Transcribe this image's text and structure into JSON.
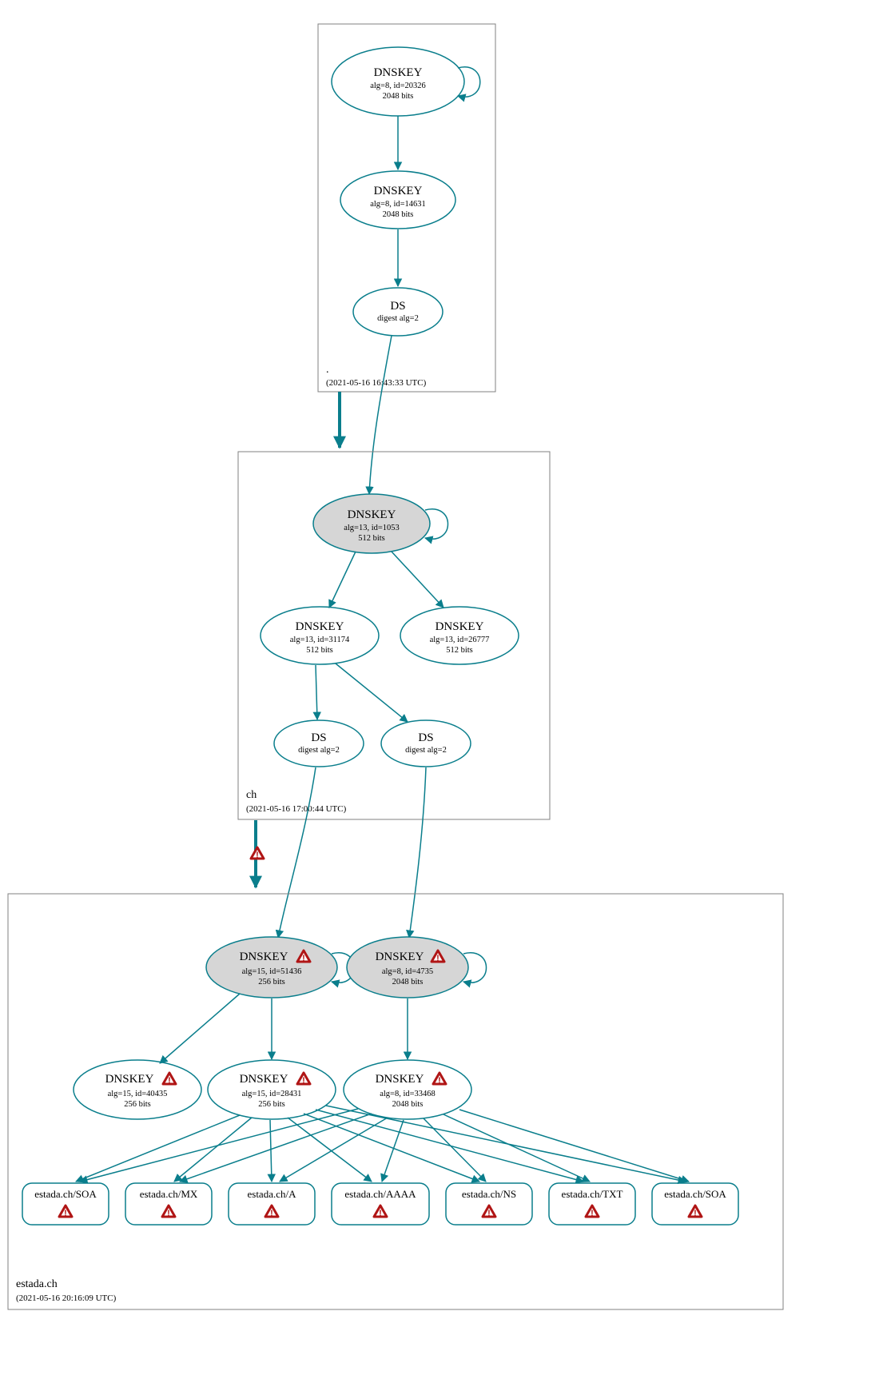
{
  "colors": {
    "stroke": "#0a7e8c",
    "fill_grey": "#d6d6d6",
    "warn": "#b01515"
  },
  "zones": {
    "root": {
      "name": ".",
      "timestamp": "(2021-05-16 16:43:33 UTC)"
    },
    "ch": {
      "name": "ch",
      "timestamp": "(2021-05-16 17:00:44 UTC)"
    },
    "estada": {
      "name": "estada.ch",
      "timestamp": "(2021-05-16 20:16:09 UTC)"
    }
  },
  "nodes": {
    "root_ksk": {
      "title": "DNSKEY",
      "line1": "alg=8, id=20326",
      "line2": "2048 bits"
    },
    "root_zsk": {
      "title": "DNSKEY",
      "line1": "alg=8, id=14631",
      "line2": "2048 bits"
    },
    "root_ds": {
      "title": "DS",
      "line1": "digest alg=2",
      "line2": ""
    },
    "ch_ksk": {
      "title": "DNSKEY",
      "line1": "alg=13, id=1053",
      "line2": "512 bits"
    },
    "ch_zsk1": {
      "title": "DNSKEY",
      "line1": "alg=13, id=31174",
      "line2": "512 bits"
    },
    "ch_zsk2": {
      "title": "DNSKEY",
      "line1": "alg=13, id=26777",
      "line2": "512 bits"
    },
    "ch_ds1": {
      "title": "DS",
      "line1": "digest alg=2",
      "line2": ""
    },
    "ch_ds2": {
      "title": "DS",
      "line1": "digest alg=2",
      "line2": ""
    },
    "est_ksk1": {
      "title": "DNSKEY",
      "line1": "alg=15, id=51436",
      "line2": "256 bits"
    },
    "est_ksk2": {
      "title": "DNSKEY",
      "line1": "alg=8, id=4735",
      "line2": "2048 bits"
    },
    "est_zsk0": {
      "title": "DNSKEY",
      "line1": "alg=15, id=40435",
      "line2": "256 bits"
    },
    "est_zsk1": {
      "title": "DNSKEY",
      "line1": "alg=15, id=28431",
      "line2": "256 bits"
    },
    "est_zsk2": {
      "title": "DNSKEY",
      "line1": "alg=8, id=33468",
      "line2": "2048 bits"
    }
  },
  "records": {
    "r0": "estada.ch/SOA",
    "r1": "estada.ch/MX",
    "r2": "estada.ch/A",
    "r3": "estada.ch/AAAA",
    "r4": "estada.ch/NS",
    "r5": "estada.ch/TXT",
    "r6": "estada.ch/SOA"
  }
}
